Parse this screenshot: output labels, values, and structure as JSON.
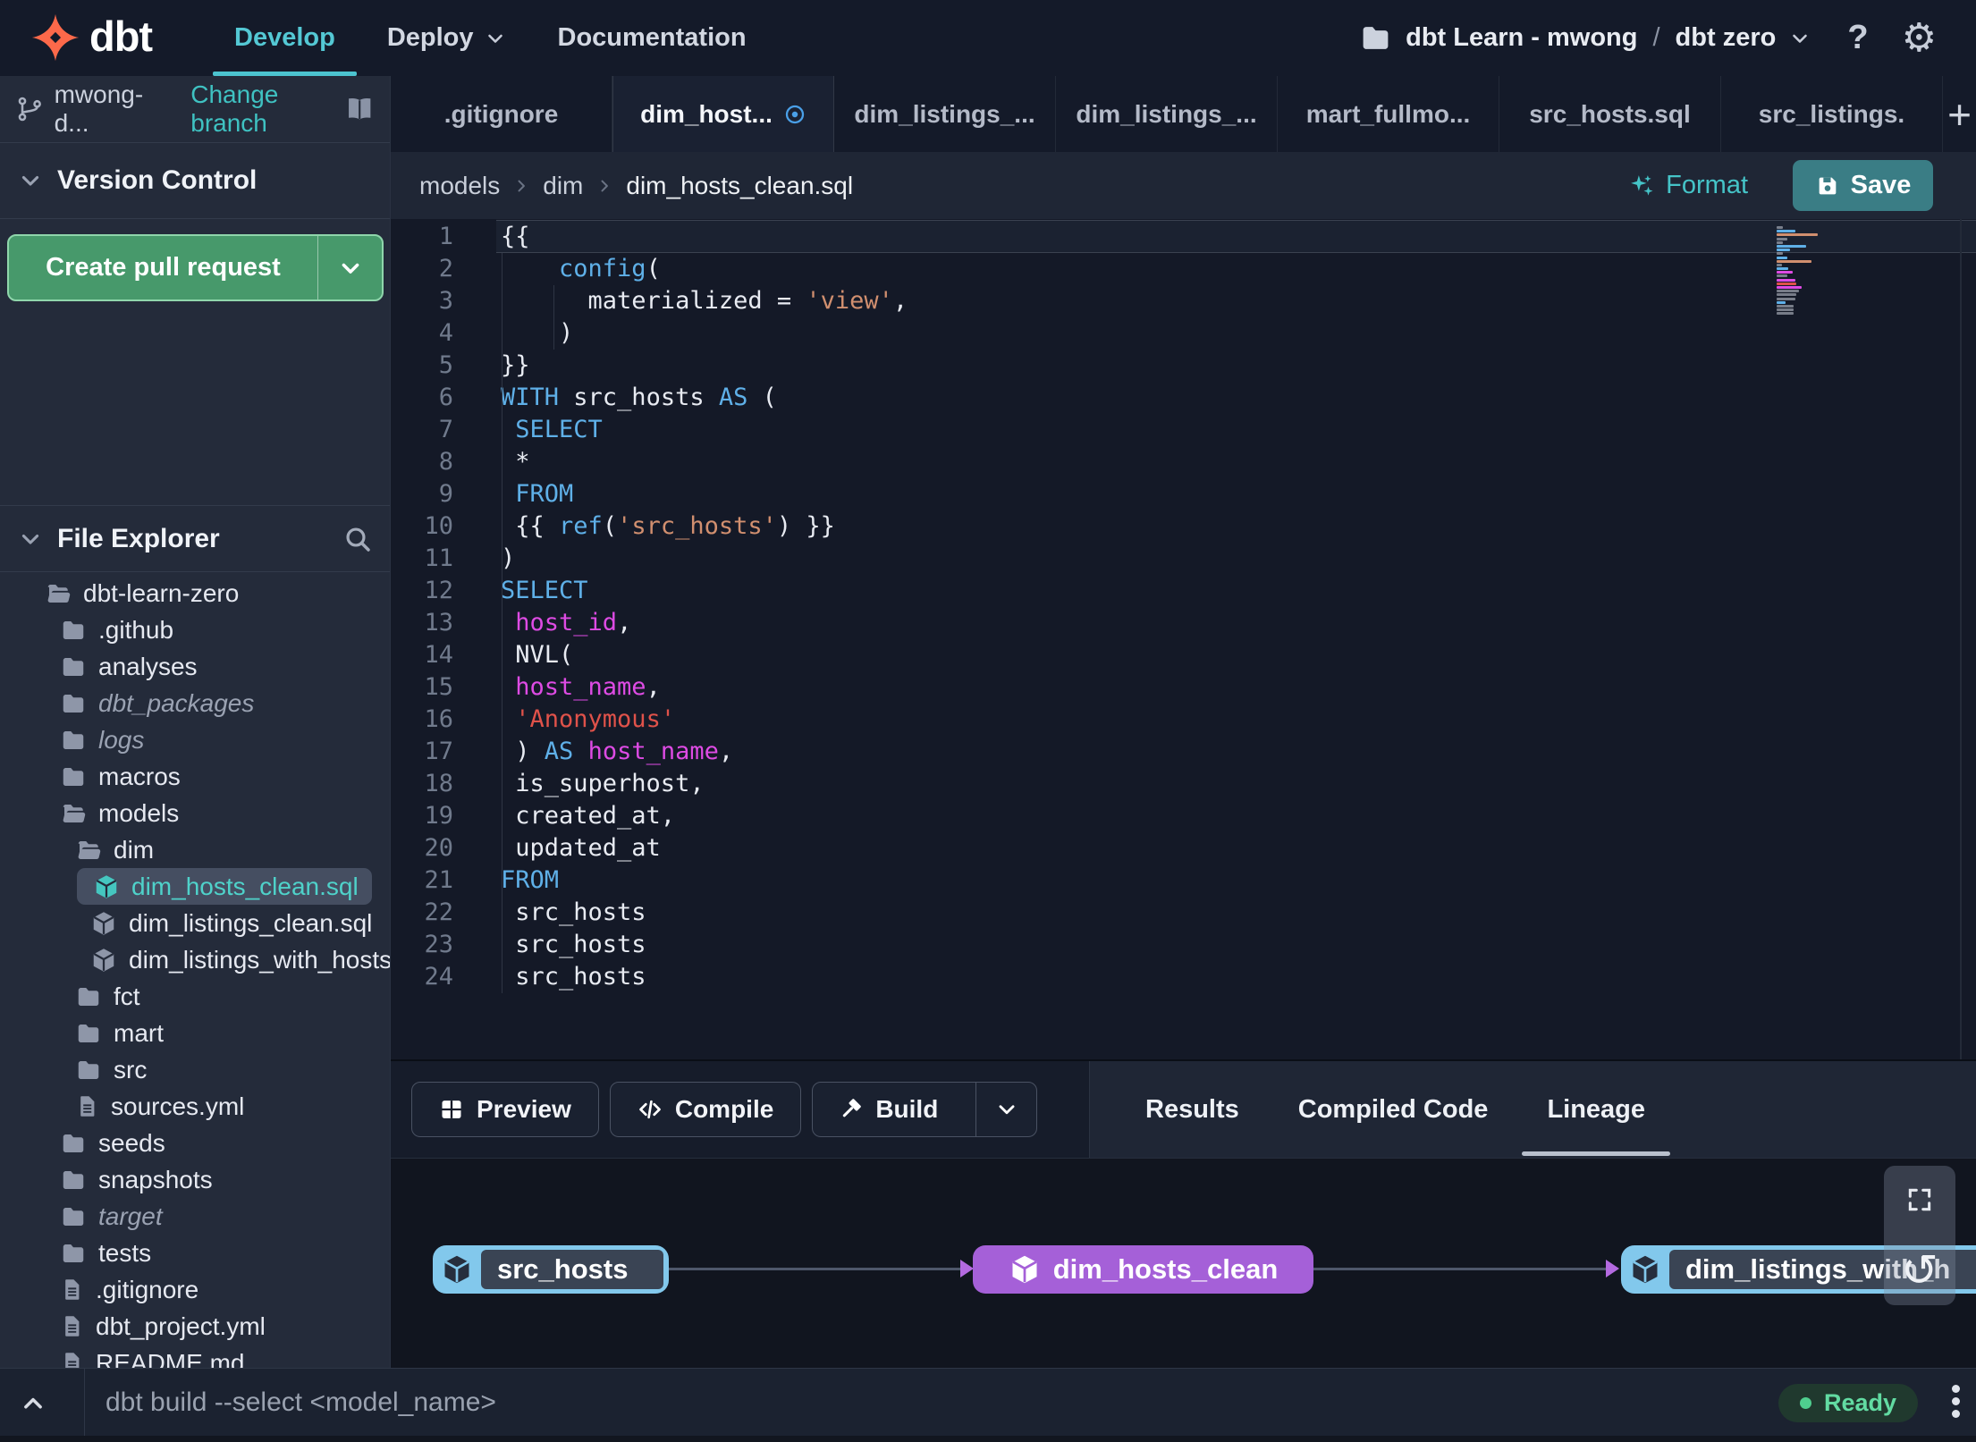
{
  "colors": {
    "accent_teal": "#45c4c8",
    "nav_active_teal": "#54c8d4",
    "green_button": "#47996b",
    "purple_node": "#a560d8",
    "blue_node_border": "#82c8ec",
    "ready_green": "#57d694",
    "dirty_blue": "#4aa0e8",
    "code_keyword": "#5fb0e8",
    "code_string_orange": "#d18f6f",
    "code_string_red": "#e0524a",
    "code_identifier": "#de4be4"
  },
  "topnav": {
    "brand": "dbt",
    "items": [
      {
        "label": "Develop",
        "active": true,
        "chevron": false
      },
      {
        "label": "Deploy",
        "active": false,
        "chevron": true
      },
      {
        "label": "Documentation",
        "active": false,
        "chevron": false
      }
    ],
    "project_switcher": {
      "account": "dbt Learn - mwong",
      "separator": "/",
      "project": "dbt zero"
    },
    "help_label": "?"
  },
  "sidebar": {
    "branch": {
      "name": "mwong-d...",
      "change_link": "Change branch"
    },
    "version_control": {
      "title": "Version Control",
      "create_pr_label": "Create pull request"
    },
    "file_explorer": {
      "title": "File Explorer",
      "tree": [
        {
          "label": "dbt-learn-zero",
          "icon": "folder-open",
          "depth": 0
        },
        {
          "label": ".github",
          "icon": "folder",
          "depth": 1
        },
        {
          "label": "analyses",
          "icon": "folder",
          "depth": 1
        },
        {
          "label": "dbt_packages",
          "icon": "folder",
          "depth": 1,
          "italic": true
        },
        {
          "label": "logs",
          "icon": "folder",
          "depth": 1,
          "italic": true
        },
        {
          "label": "macros",
          "icon": "folder",
          "depth": 1
        },
        {
          "label": "models",
          "icon": "folder-open",
          "depth": 1
        },
        {
          "label": "dim",
          "icon": "folder-open",
          "depth": 2
        },
        {
          "label": "dim_hosts_clean.sql",
          "icon": "model",
          "depth": 3,
          "selected": true,
          "dirty": true
        },
        {
          "label": "dim_listings_clean.sql",
          "icon": "model",
          "depth": 3
        },
        {
          "label": "dim_listings_with_hosts...",
          "icon": "model",
          "depth": 3
        },
        {
          "label": "fct",
          "icon": "folder",
          "depth": 2
        },
        {
          "label": "mart",
          "icon": "folder",
          "depth": 2
        },
        {
          "label": "src",
          "icon": "folder",
          "depth": 2
        },
        {
          "label": "sources.yml",
          "icon": "file",
          "depth": 2
        },
        {
          "label": "seeds",
          "icon": "folder",
          "depth": 1
        },
        {
          "label": "snapshots",
          "icon": "folder",
          "depth": 1
        },
        {
          "label": "target",
          "icon": "folder",
          "depth": 1,
          "italic": true
        },
        {
          "label": "tests",
          "icon": "folder",
          "depth": 1
        },
        {
          "label": ".gitignore",
          "icon": "file",
          "depth": 1
        },
        {
          "label": "dbt_project.yml",
          "icon": "file",
          "depth": 1
        },
        {
          "label": "README.md",
          "icon": "file",
          "depth": 1
        }
      ]
    }
  },
  "tabbar": {
    "tabs": [
      {
        "label": ".gitignore"
      },
      {
        "label": "dim_host...",
        "active": true,
        "dirty": true
      },
      {
        "label": "dim_listings_..."
      },
      {
        "label": "dim_listings_..."
      },
      {
        "label": "mart_fullmo..."
      },
      {
        "label": "src_hosts.sql"
      },
      {
        "label": "src_listings."
      }
    ],
    "new_tab_label": "+"
  },
  "editor": {
    "breadcrumb": [
      "models",
      "dim",
      "dim_hosts_clean.sql"
    ],
    "format_label": "Format",
    "save_label": "Save",
    "code_lines": [
      {
        "n": 1,
        "tokens": [
          {
            "t": "{{",
            "c": "pl"
          }
        ]
      },
      {
        "n": 2,
        "tokens": [
          {
            "t": "    ",
            "c": "pl"
          },
          {
            "t": "config",
            "c": "kw"
          },
          {
            "t": "(",
            "c": "pl"
          }
        ]
      },
      {
        "n": 3,
        "tokens": [
          {
            "t": "      materialized = ",
            "c": "pl"
          },
          {
            "t": "'view'",
            "c": "str"
          },
          {
            "t": ",",
            "c": "pl"
          }
        ]
      },
      {
        "n": 4,
        "tokens": [
          {
            "t": "    )",
            "c": "pl"
          }
        ]
      },
      {
        "n": 5,
        "tokens": [
          {
            "t": "}}",
            "c": "pl"
          }
        ]
      },
      {
        "n": 6,
        "tokens": [
          {
            "t": "WITH",
            "c": "kw"
          },
          {
            "t": " src_hosts ",
            "c": "pl"
          },
          {
            "t": "AS",
            "c": "kw"
          },
          {
            "t": " (",
            "c": "pl"
          }
        ]
      },
      {
        "n": 7,
        "tokens": [
          {
            "t": " ",
            "c": "pl"
          },
          {
            "t": "SELECT",
            "c": "kw"
          }
        ]
      },
      {
        "n": 8,
        "tokens": [
          {
            "t": " *",
            "c": "pl"
          }
        ]
      },
      {
        "n": 9,
        "tokens": [
          {
            "t": " ",
            "c": "pl"
          },
          {
            "t": "FROM",
            "c": "kw"
          }
        ]
      },
      {
        "n": 10,
        "tokens": [
          {
            "t": " {{ ",
            "c": "pl"
          },
          {
            "t": "ref",
            "c": "kw"
          },
          {
            "t": "(",
            "c": "pl"
          },
          {
            "t": "'src_hosts'",
            "c": "str"
          },
          {
            "t": ") }}",
            "c": "pl"
          }
        ]
      },
      {
        "n": 11,
        "tokens": [
          {
            "t": ")",
            "c": "pl"
          }
        ]
      },
      {
        "n": 12,
        "tokens": [
          {
            "t": "SELECT",
            "c": "kw"
          }
        ]
      },
      {
        "n": 13,
        "tokens": [
          {
            "t": " ",
            "c": "pl"
          },
          {
            "t": "host_id",
            "c": "id"
          },
          {
            "t": ",",
            "c": "pl"
          }
        ]
      },
      {
        "n": 14,
        "tokens": [
          {
            "t": " NVL(",
            "c": "pl"
          }
        ]
      },
      {
        "n": 15,
        "tokens": [
          {
            "t": " ",
            "c": "pl"
          },
          {
            "t": "host_name",
            "c": "id"
          },
          {
            "t": ",",
            "c": "pl"
          }
        ]
      },
      {
        "n": 16,
        "tokens": [
          {
            "t": " ",
            "c": "pl"
          },
          {
            "t": "'Anonymous'",
            "c": "strr"
          }
        ]
      },
      {
        "n": 17,
        "tokens": [
          {
            "t": " ) ",
            "c": "pl"
          },
          {
            "t": "AS",
            "c": "kw"
          },
          {
            "t": " ",
            "c": "pl"
          },
          {
            "t": "host_name",
            "c": "id"
          },
          {
            "t": ",",
            "c": "pl"
          }
        ]
      },
      {
        "n": 18,
        "tokens": [
          {
            "t": " is_superhost,",
            "c": "pl"
          }
        ]
      },
      {
        "n": 19,
        "tokens": [
          {
            "t": " created_at,",
            "c": "pl"
          }
        ]
      },
      {
        "n": 20,
        "tokens": [
          {
            "t": " updated_at",
            "c": "pl"
          }
        ]
      },
      {
        "n": 21,
        "tokens": [
          {
            "t": "FROM",
            "c": "kw"
          }
        ]
      },
      {
        "n": 22,
        "tokens": [
          {
            "t": " src_hosts",
            "c": "pl"
          }
        ]
      },
      {
        "n": 23,
        "tokens": [
          {
            "t": " src_hosts",
            "c": "pl"
          }
        ]
      },
      {
        "n": 24,
        "tokens": [
          {
            "t": " src_hosts",
            "c": "pl"
          }
        ]
      }
    ]
  },
  "bottom_panel": {
    "actions": [
      {
        "label": "Preview",
        "icon": "grid",
        "split": false
      },
      {
        "label": "Compile",
        "icon": "code",
        "split": false
      },
      {
        "label": "Build",
        "icon": "hammer",
        "split": true
      }
    ],
    "tabs": [
      {
        "label": "Results"
      },
      {
        "label": "Compiled Code"
      },
      {
        "label": "Lineage",
        "active": true
      }
    ],
    "lineage": {
      "nodes": [
        {
          "label": "src_hosts",
          "kind": "accent"
        },
        {
          "label": "dim_hosts_clean",
          "kind": "selected"
        },
        {
          "label": "dim_listings_with_h",
          "kind": "accent"
        }
      ]
    }
  },
  "statusbar": {
    "command_placeholder": "dbt build --select <model_name>",
    "status_label": "Ready"
  }
}
